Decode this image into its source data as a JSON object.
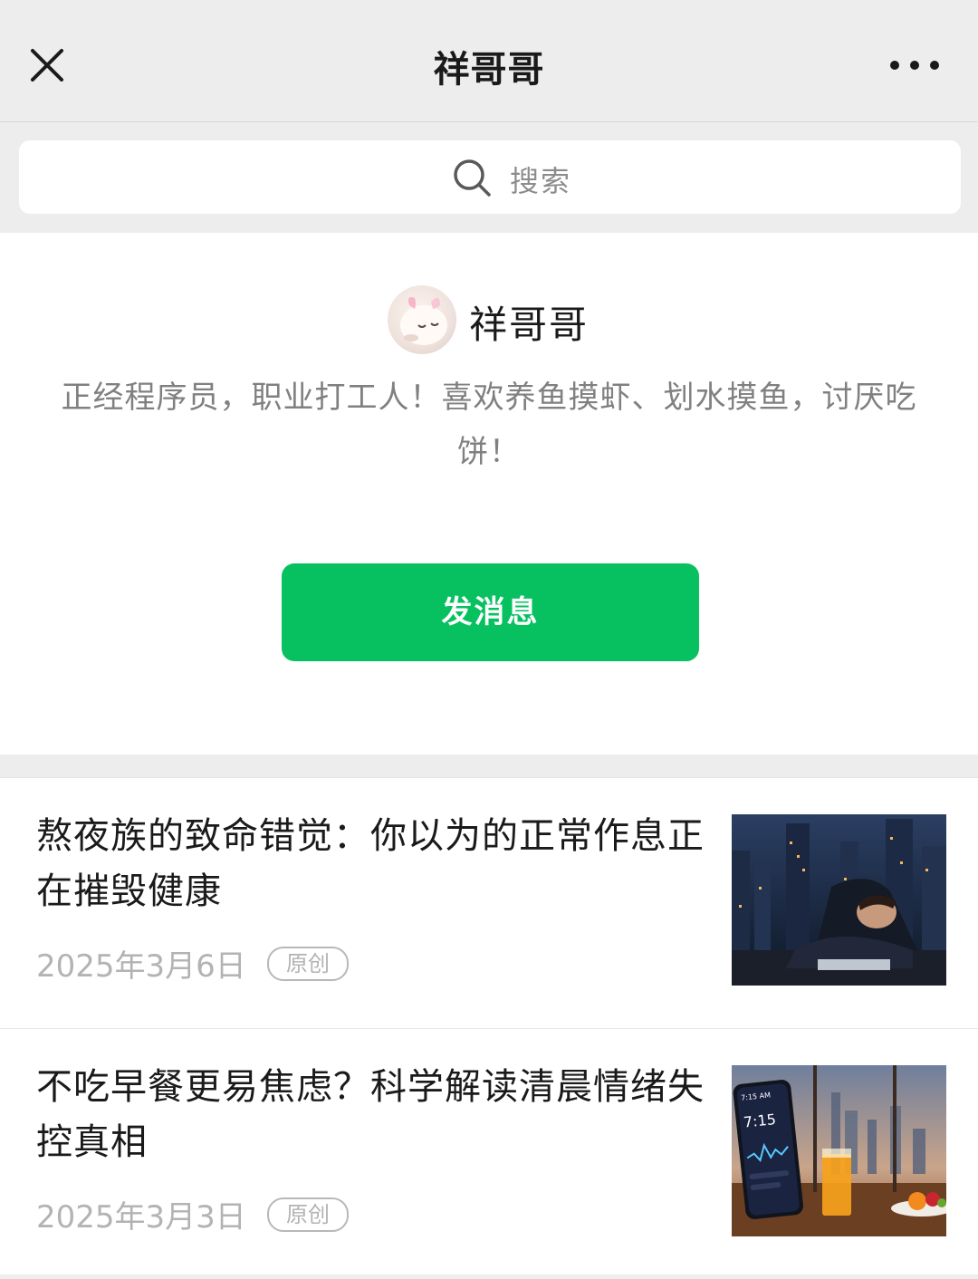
{
  "header": {
    "title": "祥哥哥",
    "close_icon": "close-icon",
    "more_icon": "more-dots-icon"
  },
  "search": {
    "placeholder": "搜索",
    "icon": "search-icon"
  },
  "profile": {
    "name": "祥哥哥",
    "bio": "正经程序员，职业打工人！喜欢养鱼摸虾、划水摸鱼，讨厌吃饼！",
    "send_button": "发消息",
    "accent_color": "#07c160"
  },
  "articles": [
    {
      "title": "熬夜族的致命错觉：你以为的正常作息正在摧毁健康",
      "date": "2025年3月6日",
      "badge": "原创"
    },
    {
      "title": "不吃早餐更易焦虑？科学解读清晨情绪失控真相",
      "date": "2025年3月3日",
      "badge": "原创",
      "thumb_time": "7:15",
      "thumb_time_small": "7:15 AM"
    }
  ]
}
